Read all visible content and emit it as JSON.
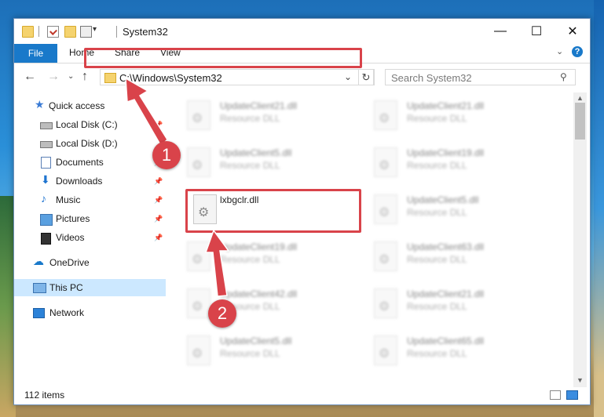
{
  "window": {
    "title": "System32",
    "controls": {
      "minimize": "—",
      "maximize": "☐",
      "close": "✕"
    }
  },
  "ribbon": {
    "tabs": [
      "File",
      "Home",
      "Share",
      "View"
    ],
    "help": "?"
  },
  "address": {
    "path": "C:\\Windows\\System32",
    "refresh": "↻"
  },
  "search": {
    "placeholder": "Search System32"
  },
  "sidebar": {
    "items": [
      {
        "label": "Quick access",
        "icon": "star-icon"
      },
      {
        "label": "Local Disk (C:)",
        "icon": "drive-icon",
        "pinned": true
      },
      {
        "label": "Local Disk (D:)",
        "icon": "drive-icon"
      },
      {
        "label": "Documents",
        "icon": "documents-icon",
        "pinned": true
      },
      {
        "label": "Downloads",
        "icon": "downloads-icon",
        "pinned": true
      },
      {
        "label": "Music",
        "icon": "music-icon",
        "pinned": true
      },
      {
        "label": "Pictures",
        "icon": "pictures-icon",
        "pinned": true
      },
      {
        "label": "Videos",
        "icon": "videos-icon",
        "pinned": true
      },
      {
        "label": "OneDrive",
        "icon": "onedrive-icon"
      },
      {
        "label": "This PC",
        "icon": "this-pc-icon",
        "selected": true
      },
      {
        "label": "Network",
        "icon": "network-icon"
      }
    ]
  },
  "files": {
    "left": [
      {
        "name": "UpdateClient21.dll",
        "type": "Resource DLL"
      },
      {
        "name": "UpdateClient5.dll",
        "type": "Resource DLL"
      },
      {
        "name": "lxbgclr.dll",
        "type": ""
      },
      {
        "name": "UpdateClient19.dll",
        "type": "Resource DLL"
      },
      {
        "name": "UpdateClient42.dll",
        "type": "Resource DLL"
      },
      {
        "name": "UpdateClient5.dll",
        "type": "Resource DLL"
      }
    ],
    "right": [
      {
        "name": "UpdateClient21.dll",
        "type": "Resource DLL"
      },
      {
        "name": "UpdateClient19.dll",
        "type": "Resource DLL"
      },
      {
        "name": "UpdateClient5.dll",
        "type": "Resource DLL"
      },
      {
        "name": "UpdateClient63.dll",
        "type": "Resource DLL"
      },
      {
        "name": "UpdateClient21.dll",
        "type": "Resource DLL"
      },
      {
        "name": "UpdateClient65.dll",
        "type": "Resource DLL"
      }
    ]
  },
  "status": {
    "items_count": "112 items"
  },
  "annotations": {
    "step1": "1",
    "step2": "2",
    "color": "#d9434a"
  }
}
